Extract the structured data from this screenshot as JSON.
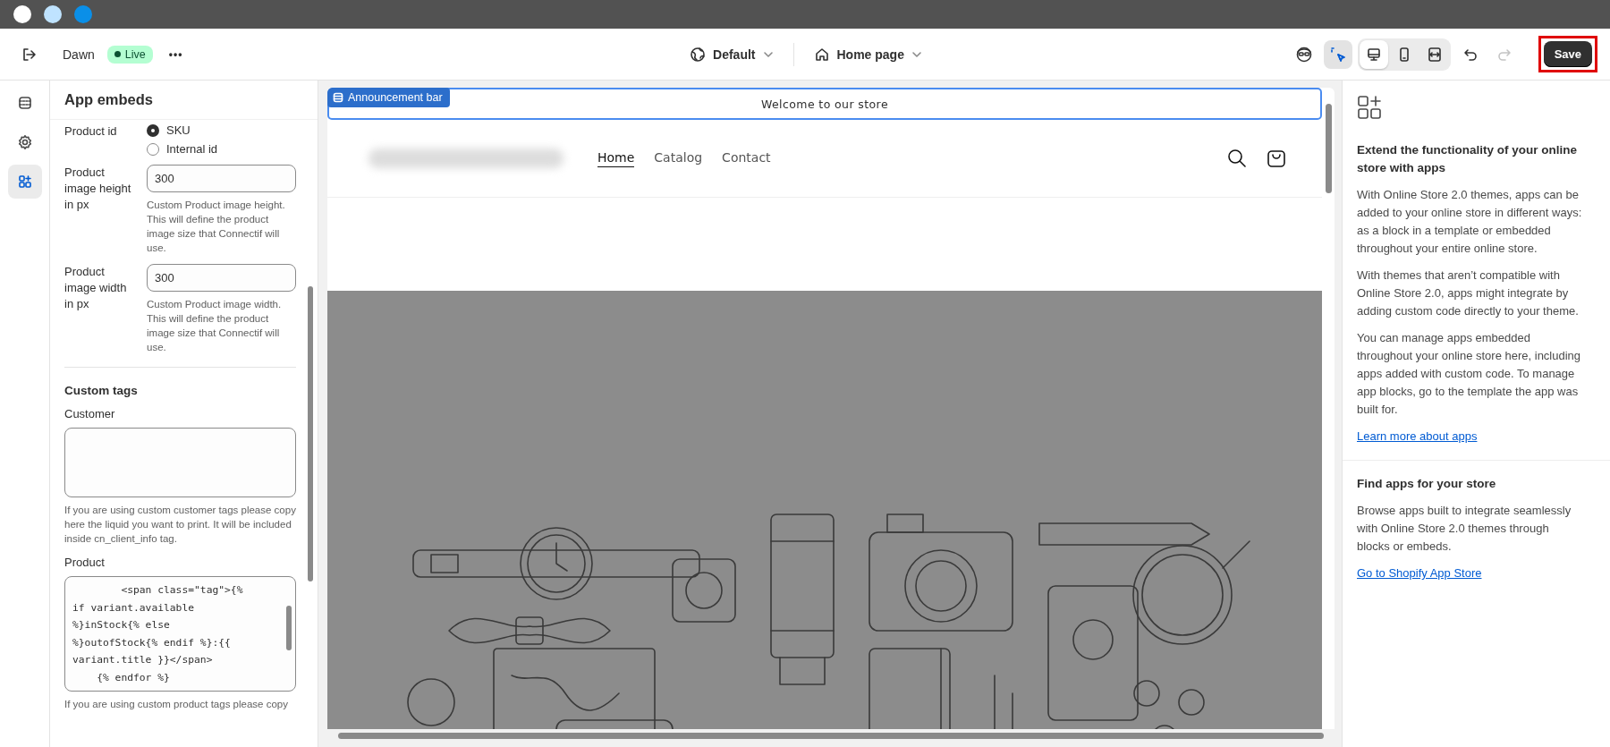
{
  "window_controls": [
    {
      "color": "#ffffff"
    },
    {
      "color": "#bfe3ff"
    },
    {
      "color": "#0a8fe8"
    }
  ],
  "toolbar": {
    "theme": "Dawn",
    "status": "Live",
    "more": "•••",
    "language": "Default",
    "template": "Home page",
    "tools": [
      {
        "kind": "inspector",
        "selected": true
      }
    ],
    "views": [
      {
        "kind": "desktop",
        "selected": true
      },
      {
        "kind": "mobile",
        "selected": false
      },
      {
        "kind": "fullwidth",
        "selected": false
      }
    ],
    "undo": {
      "disabled": false
    },
    "redo": {
      "disabled": true
    },
    "save": {
      "label": "Save",
      "highlighted": true
    }
  },
  "rail": [
    {
      "kind": "sections",
      "selected": false
    },
    {
      "kind": "settings",
      "selected": false
    },
    {
      "kind": "apps",
      "selected": true
    }
  ],
  "panel": {
    "title": "App embeds",
    "fields": [
      {
        "kind": "radio",
        "label": "Product id",
        "options": [
          {
            "label": "SKU",
            "selected": true
          },
          {
            "label": "Internal id",
            "selected": false
          }
        ]
      },
      {
        "kind": "number",
        "label": "Product image height in px",
        "value": "300",
        "help": "Custom Product image height. This will define the product image size that Connectif will use."
      },
      {
        "kind": "number",
        "label": "Product image width in px",
        "value": "300",
        "help": "Custom Product image width. This will define the product image size that Connectif will use."
      },
      {
        "kind": "heading",
        "label": "Custom tags"
      },
      {
        "kind": "textarea",
        "label": "Customer",
        "help": "If you are using custom customer tags please copy here the liquid you want to print. It will be included inside cn_client_info tag."
      },
      {
        "kind": "code",
        "label": "Product",
        "lines": [
          "        <span class=\"tag\">{%",
          "if variant.available",
          "%}inStock{% else",
          "%}outofStock{% endif %}:{{",
          "variant.title }}</span>",
          "    {% endfor %}"
        ],
        "help": "If you are using custom product tags please copy"
      }
    ]
  },
  "preview": {
    "announcement_bar": {
      "tag": "Announcement bar",
      "text": "Welcome to our store"
    },
    "nav": [
      {
        "label": "Home",
        "selected": true
      },
      {
        "label": "Catalog",
        "selected": false
      },
      {
        "label": "Contact",
        "selected": false
      }
    ]
  },
  "info": {
    "sections": [
      {
        "title": "Extend the functionality of your online store with apps",
        "paragraphs": [
          "With Online Store 2.0 themes, apps can be added to your online store in different ways: as a block in a template or embedded throughout your entire online store.",
          "With themes that aren’t compatible with Online Store 2.0, apps might integrate by adding custom code directly to your theme.",
          "You can manage apps embedded throughout your online store here, including apps added with custom code. To manage app blocks, go to the template the app was built for."
        ],
        "link": "Learn more about apps"
      },
      {
        "title": "Find apps for your store",
        "paragraphs": [
          "Browse apps built to integrate seamlessly with Online Store 2.0 themes through blocks or embeds."
        ],
        "link": "Go to Shopify App Store"
      }
    ]
  }
}
